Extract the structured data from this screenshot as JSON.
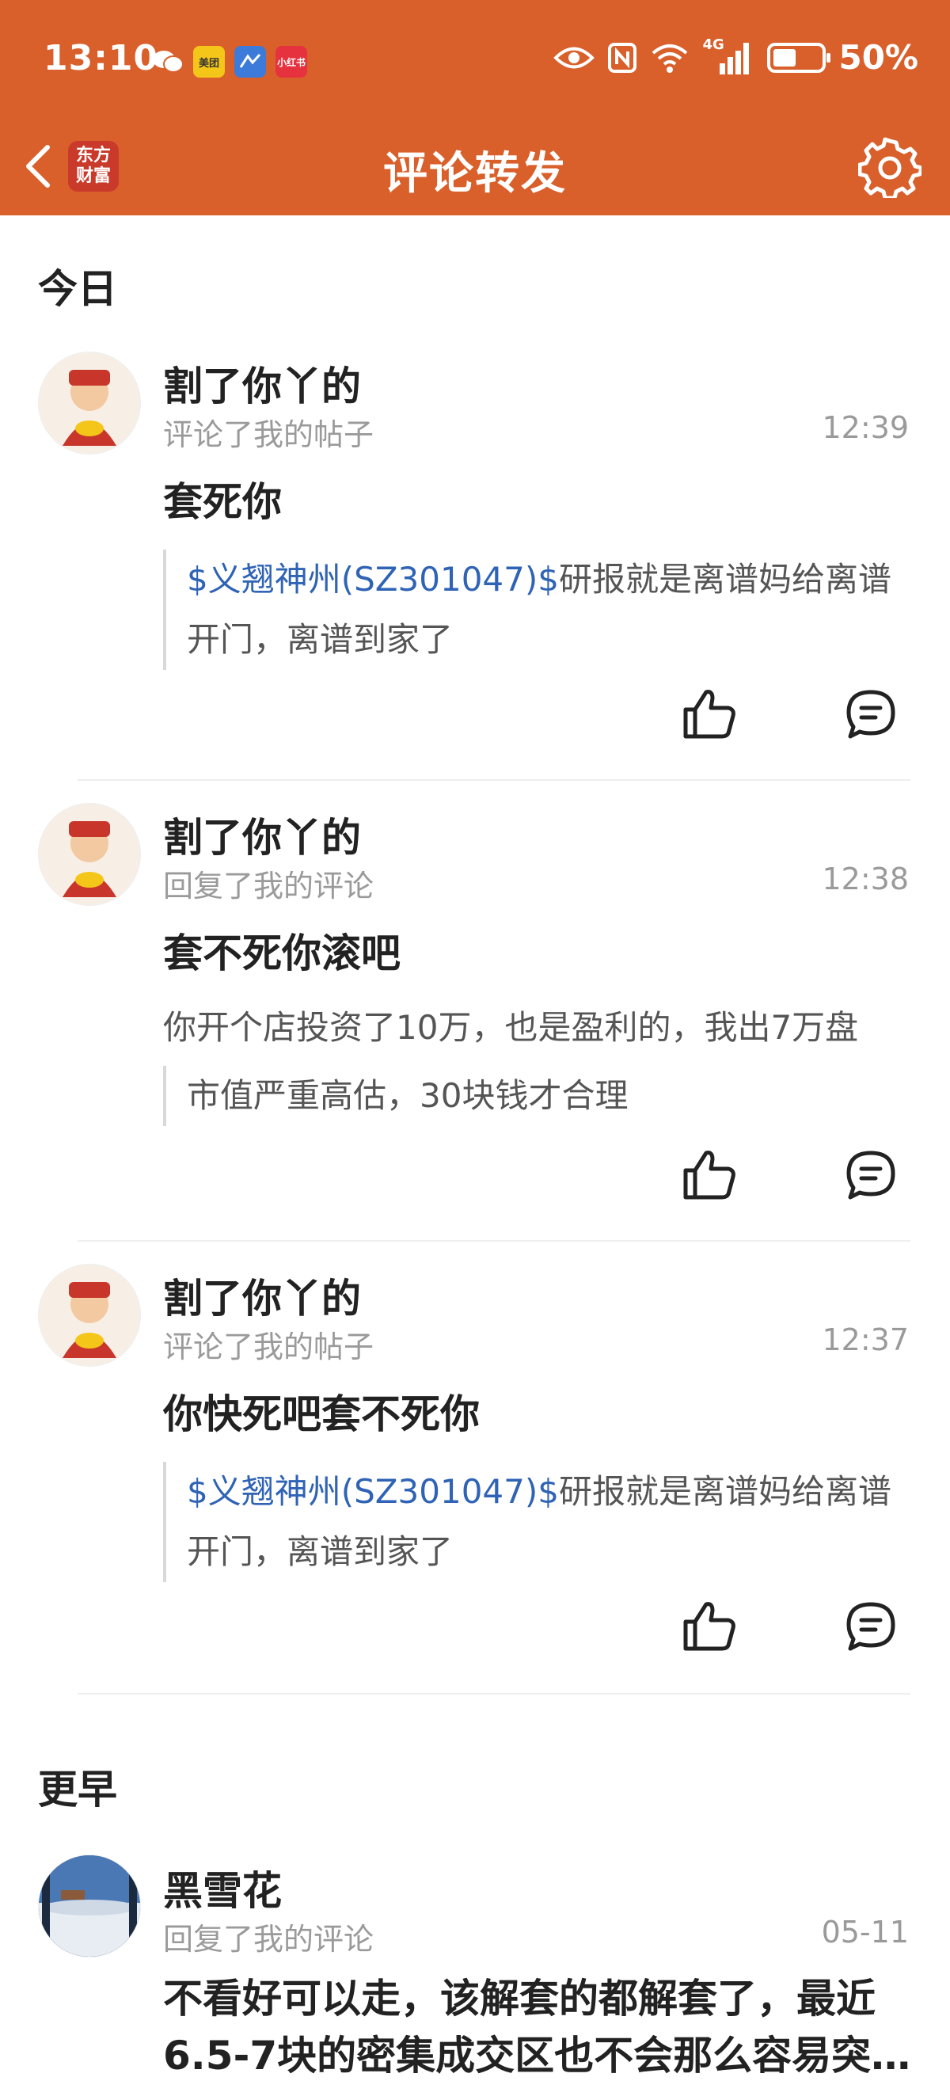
{
  "status_bar": {
    "time": "13:10",
    "apps": [
      "微信",
      "美团",
      "地图",
      "小红书"
    ],
    "network": "4G",
    "battery": "50%"
  },
  "nav": {
    "logo_text": "东方财富",
    "title": "评论转发"
  },
  "sections": {
    "today": "今日",
    "earlier": "更早"
  },
  "notifications": [
    {
      "user": "割了你丫的",
      "action": "评论了我的帖子",
      "time": "12:39",
      "content": "套死你",
      "quote_stock": "$义翘神州(SZ301047)$",
      "quote_text": "研报就是离谱妈给离谱开门，离谱到家了"
    },
    {
      "user": "割了你丫的",
      "action": "回复了我的评论",
      "time": "12:38",
      "content": "套不死你滚吧",
      "plain_text": "你开个店投资了10万，也是盈利的，我出7万盘",
      "quote_text": "市值严重高估，30块钱才合理"
    },
    {
      "user": "割了你丫的",
      "action": "评论了我的帖子",
      "time": "12:37",
      "content": "你快死吧套不死你",
      "quote_stock": "$义翘神州(SZ301047)$",
      "quote_text": "研报就是离谱妈给离谱开门，离谱到家了"
    },
    {
      "user": "黑雪花",
      "action": "回复了我的评论",
      "time": "05-11",
      "content": "不看好可以走，该解套的都解套了，最近6.5-7块的密集成交区也不会那么容易突…"
    }
  ],
  "icons": {
    "like": "thumbs-up-icon",
    "comment": "comment-icon",
    "back": "back-arrow-icon",
    "settings": "gear-icon"
  },
  "colors": {
    "brand": "#D9602B",
    "stock_link": "#2F63B5"
  }
}
